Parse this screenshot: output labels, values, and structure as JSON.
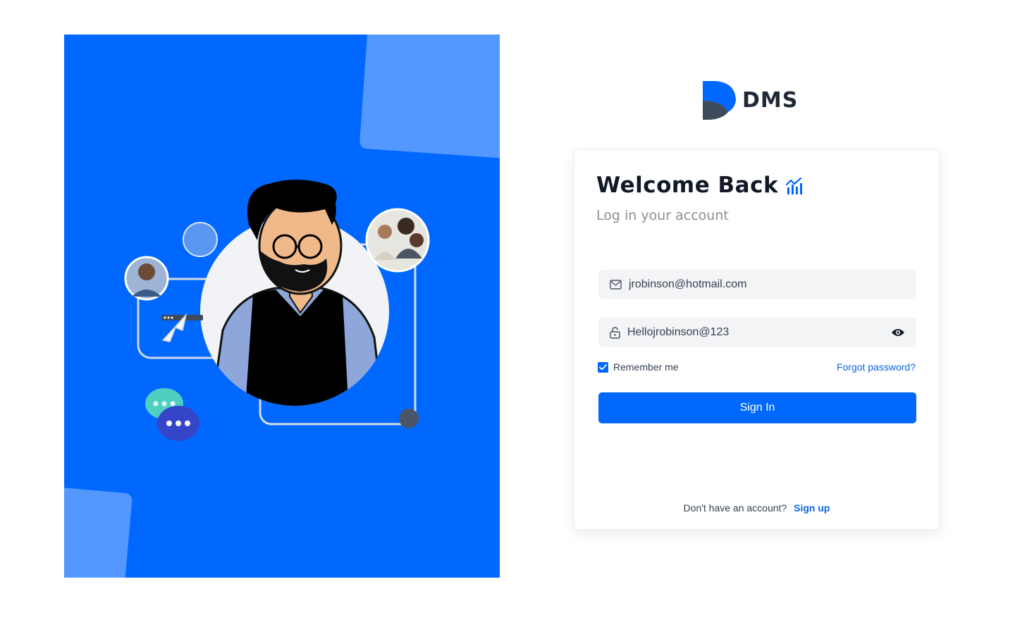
{
  "brand": {
    "name": "DMS"
  },
  "login": {
    "title": "Welcome Back",
    "subtitle": "Log in your account",
    "email_value": "jrobinson@hotmail.com",
    "password_value": "Hellojrobinson@123",
    "remember_label": "Remember me",
    "remember_checked": true,
    "forgot_label": "Forgot password?",
    "signin_label": "Sign In",
    "no_account_text": "Don't have an account?",
    "signup_label": "Sign up"
  },
  "icons": {
    "title_icon": "chart-icon",
    "email": "mail-icon",
    "password": "lock-icon",
    "toggle_password": "eye-icon",
    "checkbox": "check-icon"
  },
  "colors": {
    "primary": "#0068ff",
    "hero_accent": "#5397ff",
    "link": "#0a66e6",
    "input_bg": "#f3f4f6",
    "brand_dark": "#3d4a5c"
  }
}
